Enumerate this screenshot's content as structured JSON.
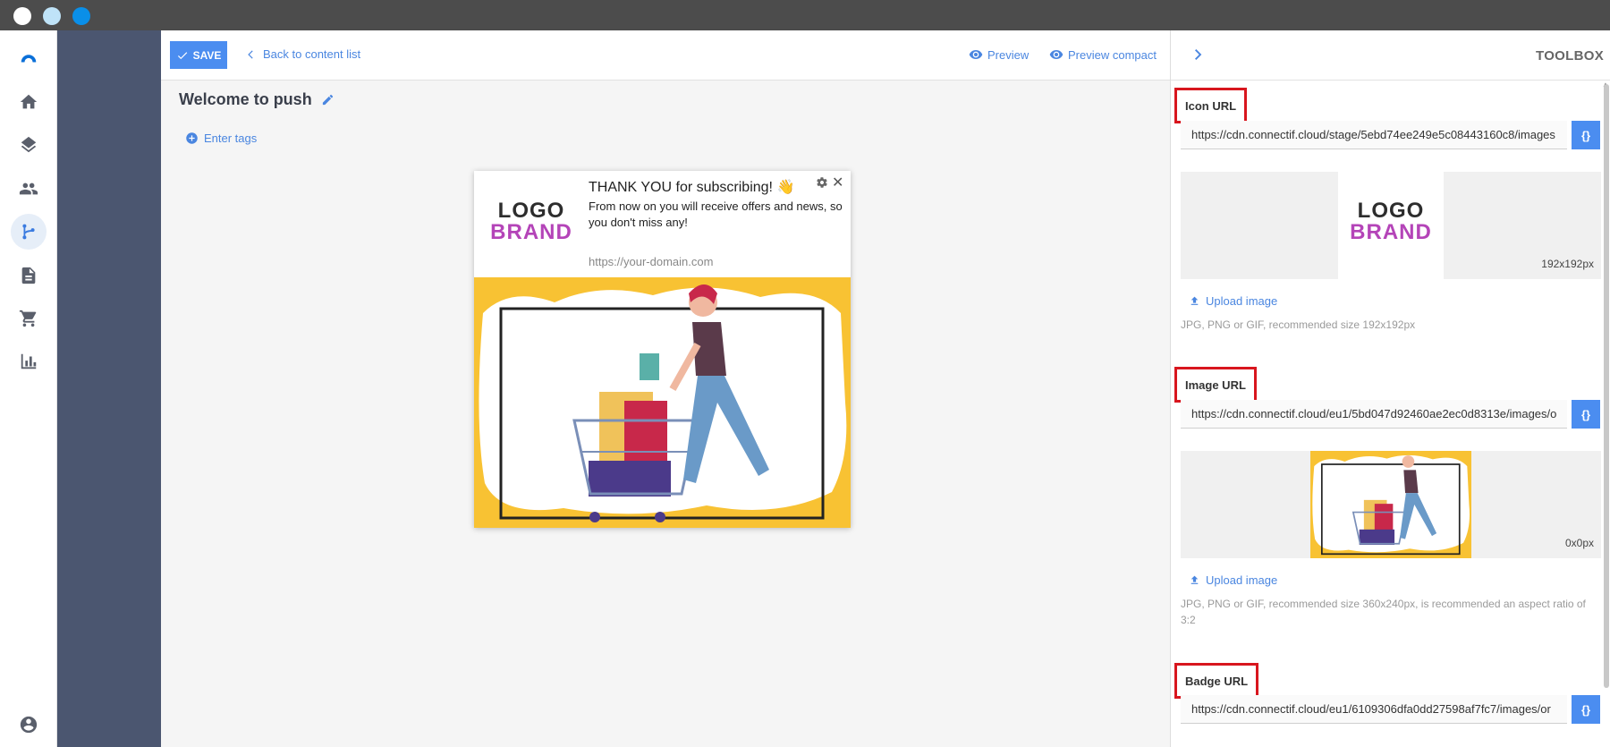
{
  "window": {
    "dots": [
      "close",
      "minimize",
      "maximize"
    ]
  },
  "rail": {
    "items": [
      {
        "name": "brand-logo-icon"
      },
      {
        "name": "home-icon"
      },
      {
        "name": "layers-icon"
      },
      {
        "name": "contacts-icon"
      },
      {
        "name": "workflow-icon",
        "active": true
      },
      {
        "name": "content-icon"
      },
      {
        "name": "cart-icon"
      },
      {
        "name": "analytics-icon"
      },
      {
        "name": "account-icon"
      }
    ]
  },
  "topbar": {
    "save_label": "SAVE",
    "back_label": "Back to content list",
    "preview_label": "Preview",
    "preview_compact_label": "Preview compact"
  },
  "editor": {
    "title": "Welcome to push",
    "tags_label": "Enter tags"
  },
  "notification": {
    "logo_line1": "LOGO",
    "logo_line2": "BRAND",
    "title": "THANK YOU for subscribing! 👋",
    "body": "From now on you will receive offers and news, so you don't miss any!",
    "url": "https://your-domain.com",
    "close_symbol": "✕"
  },
  "toolbox": {
    "title": "TOOLBOX",
    "icon": {
      "label": "Icon URL",
      "value": "https://cdn.connectif.cloud/stage/5ebd74ee249e5c08443160c8/images",
      "var_button": "{}",
      "dimensions": "192x192px",
      "upload_label": "Upload image",
      "hint": "JPG, PNG or GIF, recommended size 192x192px",
      "logo_line1": "LOGO",
      "logo_line2": "BRAND"
    },
    "image": {
      "label": "Image URL",
      "value": "https://cdn.connectif.cloud/eu1/5bd047d92460ae2ec0d8313e/images/o",
      "var_button": "{}",
      "dimensions": "0x0px",
      "upload_label": "Upload image",
      "hint": "JPG, PNG or GIF, recommended size 360x240px, is recommended an aspect ratio of 3:2"
    },
    "badge": {
      "label": "Badge URL",
      "value": "https://cdn.connectif.cloud/eu1/6109306dfa0dd27598af7fc7/images/or",
      "var_button": "{}"
    }
  },
  "colors": {
    "accent": "#4b8df0",
    "nav_panel": "#4b5670",
    "highlight_border": "#d8161e",
    "illustration_yellow": "#f8c233",
    "brand_magenta": "#b444b8"
  }
}
